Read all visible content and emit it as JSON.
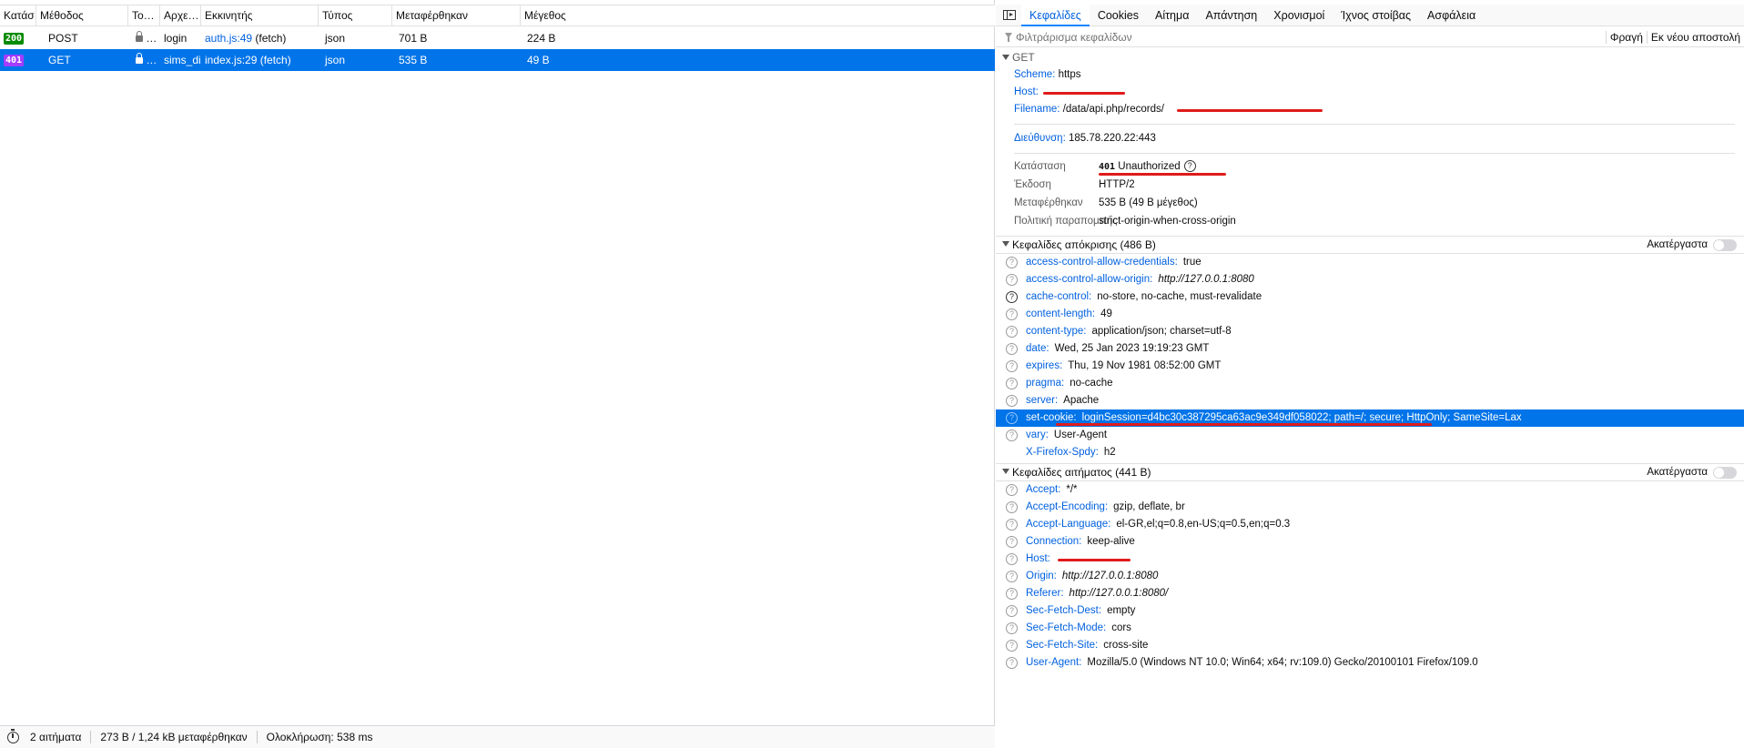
{
  "table": {
    "columns": [
      "Κατάσ…",
      "Μέθοδος",
      "Το…",
      "Αρχε…",
      "Εκκινητής",
      "Τύπος",
      "Μεταφέρθηκαν",
      "Μέγεθος"
    ],
    "rows": [
      {
        "status": "200",
        "status_color": "#058b00",
        "method": "POST",
        "file": "login",
        "initiator": "auth.js:49",
        "initiator_suffix": "(fetch)",
        "type": "json",
        "transferred": "701 B",
        "size": "224 B",
        "selected": false
      },
      {
        "status": "401",
        "status_color": "#a33cff",
        "method": "GET",
        "file": "sims_di",
        "initiator": "index.js:29",
        "initiator_suffix": "(fetch)",
        "type": "json",
        "transferred": "535 B",
        "size": "49 B",
        "selected": true
      }
    ]
  },
  "footer": {
    "requests": "2 αιτήματα",
    "transferred": "273 B / 1,24 kB μεταφέρθηκαν",
    "finish": "Ολοκλήρωση: 538 ms"
  },
  "tabs": [
    "Κεφαλίδες",
    "Cookies",
    "Αίτημα",
    "Απάντηση",
    "Χρονισμοί",
    "Ίχνος στοίβας",
    "Ασφάλεια"
  ],
  "filter": {
    "placeholder": "Φιλτράρισμα κεφαλίδων",
    "block_label": "Φραγή",
    "resend_label": "Εκ νέου αποστολή"
  },
  "summary": {
    "method": "GET",
    "scheme_key": "Scheme:",
    "scheme": "https",
    "host_key": "Host:",
    "host": "",
    "filename_key": "Filename:",
    "filename": "/data/api.php/records/",
    "address_key": "Διεύθυνση:",
    "address": "185.78.220.22:443",
    "status_key": "Κατάσταση",
    "status_code": "401",
    "status_text": "Unauthorized",
    "version_key": "Έκδοση",
    "version": "HTTP/2",
    "transferred_key": "Μεταφέρθηκαν",
    "transferred": "535 B (49 B μέγεθος)",
    "referrer_key": "Πολιτική παραπομπής",
    "referrer": "strict-origin-when-cross-origin"
  },
  "response_headers": {
    "title": "Κεφαλίδες απόκρισης (486 B)",
    "raw_label": "Ακατέργαστα",
    "items": [
      {
        "k": "access-control-allow-credentials:",
        "v": "true"
      },
      {
        "k": "access-control-allow-origin:",
        "v": "http://127.0.0.1:8080",
        "italic": true
      },
      {
        "k": "cache-control:",
        "v": "no-store, no-cache, must-revalidate"
      },
      {
        "k": "content-length:",
        "v": "49"
      },
      {
        "k": "content-type:",
        "v": "application/json; charset=utf-8"
      },
      {
        "k": "date:",
        "v": "Wed, 25 Jan 2023 19:19:23 GMT"
      },
      {
        "k": "expires:",
        "v": "Thu, 19 Nov 1981 08:52:00 GMT"
      },
      {
        "k": "pragma:",
        "v": "no-cache"
      },
      {
        "k": "server:",
        "v": "Apache"
      },
      {
        "k": "set-cookie:",
        "v": "loginSession=d4bc30c387295ca63ac9e349df058022; path=/; secure; HttpOnly; SameSite=Lax",
        "selected": true
      },
      {
        "k": "vary:",
        "v": "User-Agent"
      },
      {
        "k": "X-Firefox-Spdy:",
        "v": "h2",
        "noicon": true
      }
    ]
  },
  "request_headers": {
    "title": "Κεφαλίδες αιτήματος (441 B)",
    "raw_label": "Ακατέργαστα",
    "items": [
      {
        "k": "Accept:",
        "v": "*/*"
      },
      {
        "k": "Accept-Encoding:",
        "v": "gzip, deflate, br"
      },
      {
        "k": "Accept-Language:",
        "v": "el-GR,el;q=0.8,en-US;q=0.5,en;q=0.3"
      },
      {
        "k": "Connection:",
        "v": "keep-alive"
      },
      {
        "k": "Host:",
        "v": ""
      },
      {
        "k": "Origin:",
        "v": "http://127.0.0.1:8080",
        "italic": true
      },
      {
        "k": "Referer:",
        "v": "http://127.0.0.1:8080/",
        "italic": true
      },
      {
        "k": "Sec-Fetch-Dest:",
        "v": "empty"
      },
      {
        "k": "Sec-Fetch-Mode:",
        "v": "cors"
      },
      {
        "k": "Sec-Fetch-Site:",
        "v": "cross-site"
      },
      {
        "k": "User-Agent:",
        "v": "Mozilla/5.0 (Windows NT 10.0; Win64; x64; rv:109.0) Gecko/20100101 Firefox/109.0"
      }
    ]
  },
  "colors": {
    "accent": "#0074e8",
    "link": "#0060df",
    "status_401": "#a33cff",
    "status_200": "#058b00"
  }
}
